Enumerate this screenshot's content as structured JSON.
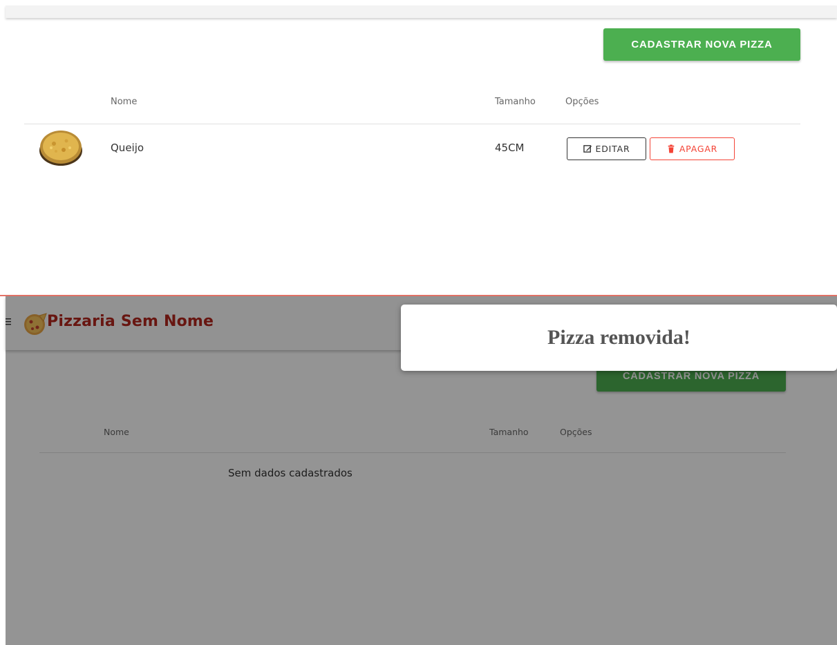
{
  "top": {
    "add_button_label": "CADASTRAR NOVA PIZZA",
    "columns": {
      "name": "Nome",
      "size": "Tamanho",
      "options": "Opções"
    },
    "rows": [
      {
        "image": "cheese-pizza-image",
        "name": "Queijo",
        "size": "45CM",
        "edit_label": "EDITAR",
        "delete_label": "APAGAR"
      }
    ]
  },
  "bottom": {
    "app_title": "Pizzaria Sem Nome",
    "add_button_label": "CADASTRAR NOVA PIZZA",
    "columns": {
      "name": "Nome",
      "size": "Tamanho",
      "options": "Opções"
    },
    "empty_message": "Sem dados cadastrados"
  },
  "toast": {
    "message": "Pizza removida!"
  },
  "colors": {
    "primary_green": "#4caf50",
    "danger_red": "#f44336",
    "brand_red": "#b3261e"
  },
  "icons": {
    "edit": "edit-icon",
    "delete": "trash-icon",
    "menu": "menu-icon",
    "logo": "pizza-logo-icon"
  }
}
